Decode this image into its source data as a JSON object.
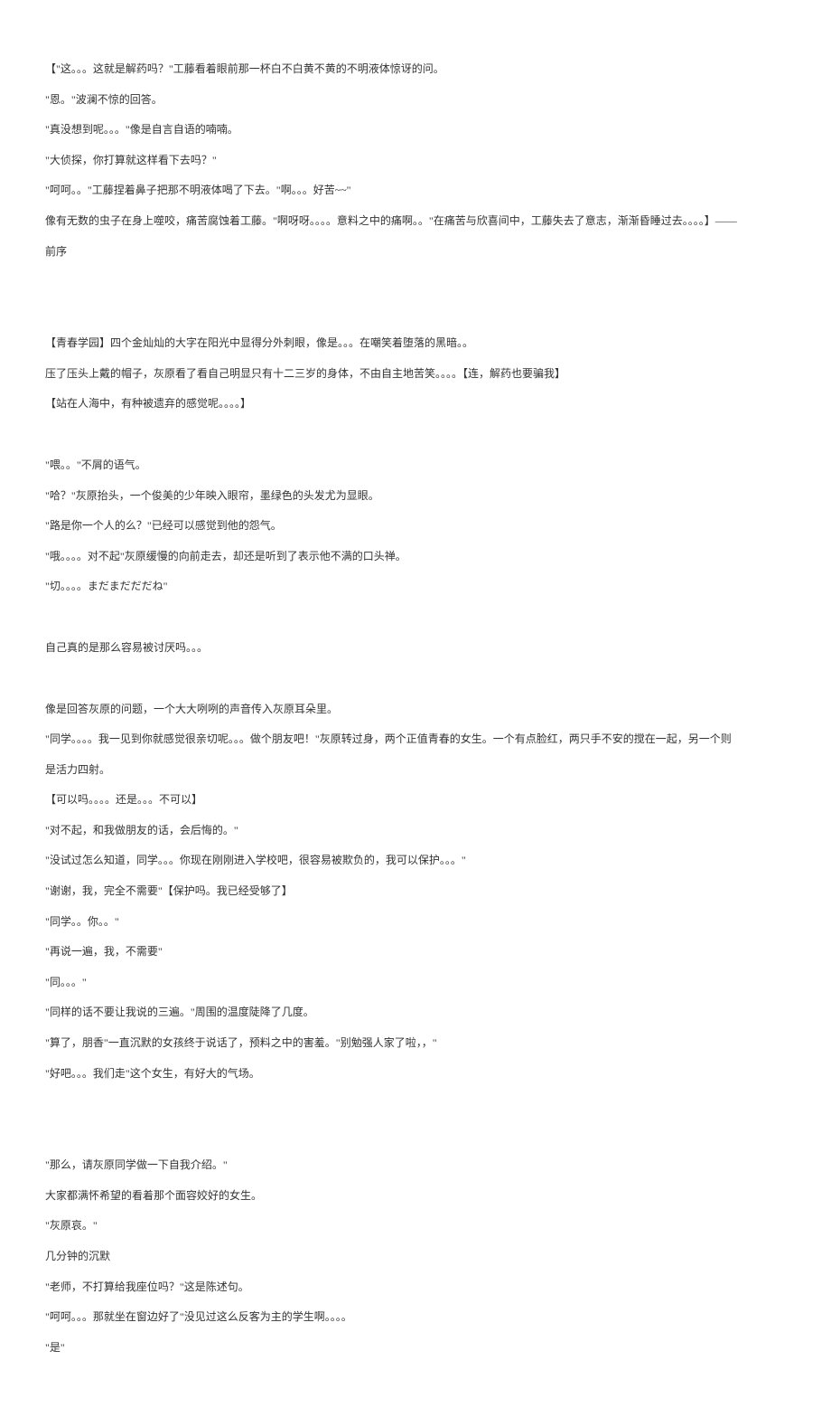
{
  "lines": [
    "【\"这。。。这就是解药吗？\"工藤看着眼前那一杯白不白黄不黄的不明液体惊讶的问。",
    "\"恩。\"波澜不惊的回答。",
    "\"真没想到呢。。。\"像是自言自语的喃喃。",
    "\"大侦探，你打算就这样看下去吗？\"",
    "\"呵呵。。\"工藤捏着鼻子把那不明液体喝了下去。\"啊。。。好苦~~\"",
    "像有无数的虫子在身上噬咬，痛苦腐蚀着工藤。\"啊呀呀。。。。意料之中的痛啊。。\"在痛苦与欣喜间中，工藤失去了意志，渐渐昏睡过去。。。。】——",
    "前序",
    "",
    "",
    "【青春学园】四个金灿灿的大字在阳光中显得分外刺眼，像是。。。在嘲笑着堕落的黑暗。。",
    "压了压头上戴的帽子，灰原看了看自己明显只有十二三岁的身体，不由自主地苦笑。。。。【连，解药也要骗我】",
    "【站在人海中，有种被遗弃的感觉呢。。。。】",
    "",
    "\"喂。。\"不屑的语气。",
    "\"哈？\"灰原抬头，一个俊美的少年映入眼帘，墨绿色的头发尤为显眼。",
    "\"路是你一个人的么？\"已经可以感觉到他的怨气。",
    "\"哦。。。。对不起\"灰原缓慢的向前走去，却还是听到了表示他不满的口头禅。",
    "\"切。。。。まだまだだだね\"",
    "",
    "自己真的是那么容易被讨厌吗。。。",
    "",
    "像是回答灰原的问题，一个大大咧咧的声音传入灰原耳朵里。",
    "\"同学。。。。我一见到你就感觉很亲切呢。。。做个朋友吧！\"灰原转过身，两个正值青春的女生。一个有点脸红，两只手不安的搅在一起，另一个则",
    "是活力四射。",
    "【可以吗。。。。还是。。。不可以】",
    "\"对不起，和我做朋友的话，会后悔的。\"",
    "\"没试过怎么知道，同学。。。你现在刚刚进入学校吧，很容易被欺负的，我可以保护。。。\"",
    "\"谢谢，我，完全不需要\"【保护吗。我已经受够了】",
    "\"同学。。你。。\"",
    "\"再说一遍，我，不需要\"",
    "\"同。。。\"",
    "\"同样的话不要让我说的三遍。\"周围的温度陡降了几度。",
    "\"算了，朋香\"一直沉默的女孩终于说话了，预料之中的害羞。\"别勉强人家了啦，，\"",
    "\"好吧。。。我们走\"这个女生，有好大的气场。",
    "",
    "",
    "\"那么，请灰原同学做一下自我介绍。\"",
    "大家都满怀希望的看着那个面容姣好的女生。",
    "\"灰原哀。\"",
    "几分钟的沉默",
    "\"老师，不打算给我座位吗？\"这是陈述句。",
    "\"呵呵。。。那就坐在窗边好了\"没见过这么反客为主的学生啊。。。。",
    "\"是\""
  ]
}
